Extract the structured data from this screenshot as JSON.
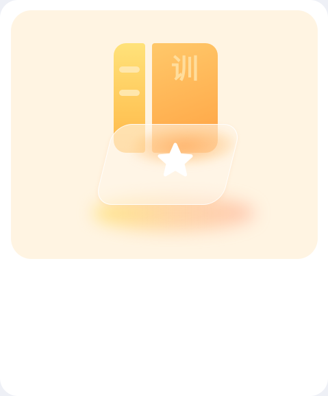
{
  "illustration": {
    "cover_character": "训",
    "icon": "star-icon",
    "colors": {
      "hero_background": "#fff4e2",
      "book_spine": "#ffd066",
      "book_cover": "#ffae4e",
      "star": "#ffffff"
    }
  }
}
